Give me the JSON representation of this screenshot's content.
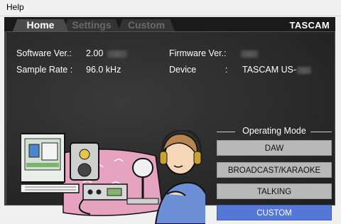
{
  "menu": {
    "help_label": "Help"
  },
  "tabs": [
    {
      "label": "Home"
    },
    {
      "label": "Settings"
    },
    {
      "label": "Custom"
    }
  ],
  "brand": {
    "logo": "TASCAM"
  },
  "info": {
    "software_label": "Software Ver.:",
    "software_value": "2.00",
    "firmware_label": "Firmware Ver.:",
    "sample_rate_label": "Sample Rate :",
    "sample_rate_value": "96.0 kHz",
    "device_label": "Device",
    "device_sep": ":",
    "device_value": "TASCAM US-"
  },
  "operating_mode": {
    "title": "Operating Mode",
    "buttons": [
      "DAW",
      "BROADCAST/KARAOKE",
      "TALKING",
      "CUSTOM"
    ],
    "selected": "CUSTOM",
    "accent": "#5577d8"
  }
}
